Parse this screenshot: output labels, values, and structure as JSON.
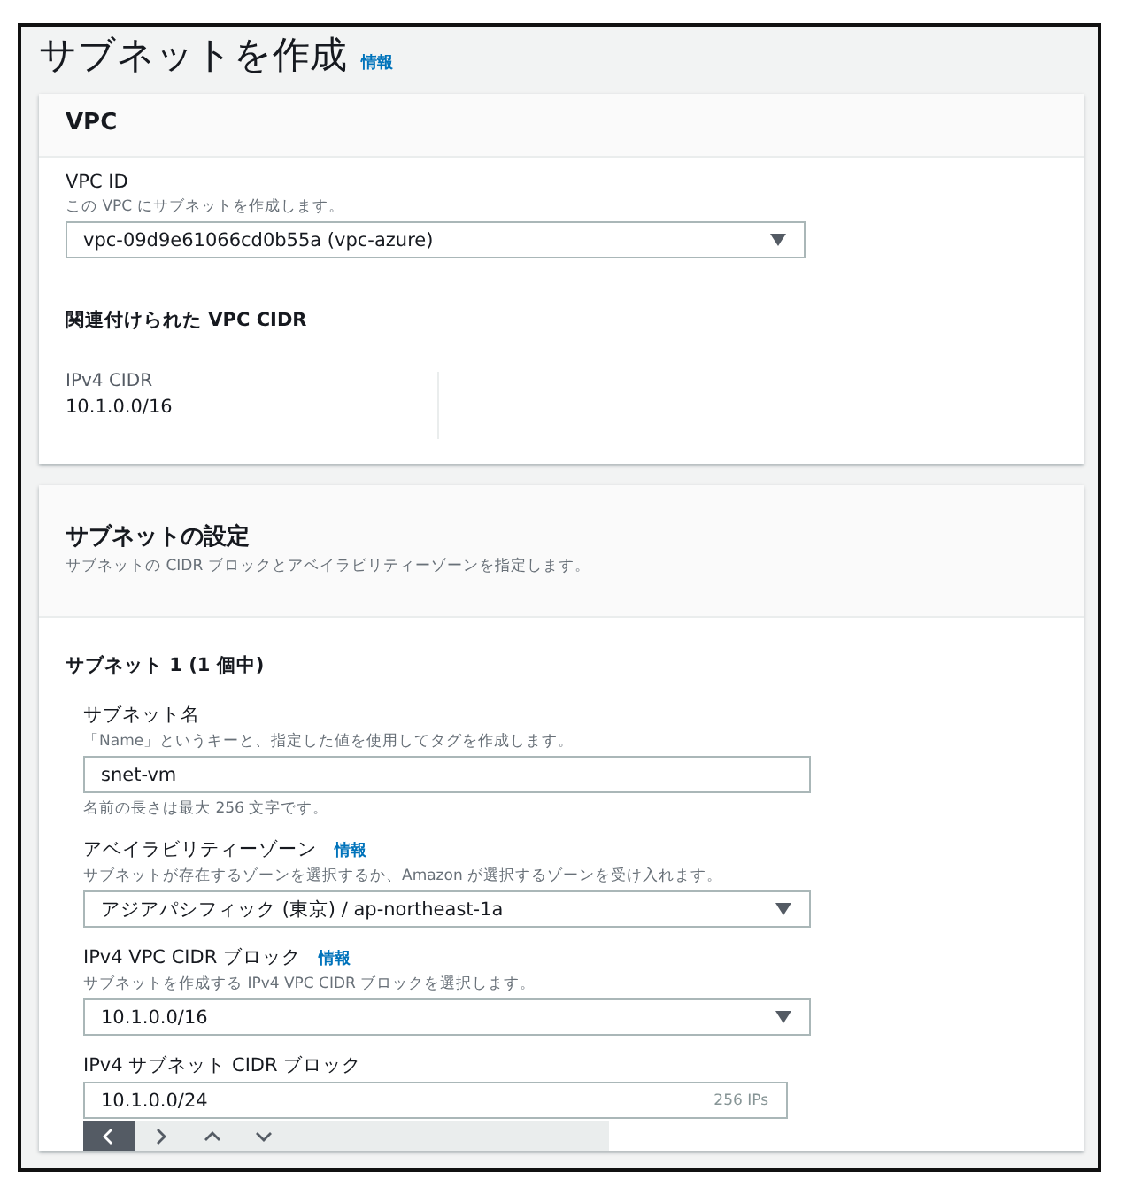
{
  "page": {
    "title": "サブネットを作成",
    "info_link": "情報"
  },
  "vpc_section": {
    "title": "VPC",
    "vpc_id": {
      "label": "VPC ID",
      "description": "この VPC にサブネットを作成します。",
      "value": "vpc-09d9e61066cd0b55a (vpc-azure)"
    },
    "cidr_heading": "関連付けられた VPC CIDR",
    "cidr_label": "IPv4 CIDR",
    "cidr_value": "10.1.0.0/16"
  },
  "subnet_section": {
    "title": "サブネットの設定",
    "description": "サブネットの CIDR ブロックとアベイラビリティーゾーンを指定します。",
    "subnet_heading": "サブネット 1 (1 個中)",
    "fields": [
      {
        "kind": "text",
        "label": "サブネット名",
        "description": "「Name」というキーと、指定した値を使用してタグを作成します。",
        "value": "snet-vm",
        "hint": "名前の長さは最大 256 文字です。"
      },
      {
        "kind": "select",
        "label": "アベイラビリティーゾーン",
        "info_link": "情報",
        "description": "サブネットが存在するゾーンを選択するか、Amazon が選択するゾーンを受け入れます。",
        "value": "アジアパシフィック (東京) / ap-northeast-1a"
      },
      {
        "kind": "select",
        "label": "IPv4 VPC CIDR ブロック",
        "info_link": "情報",
        "description": "サブネットを作成する IPv4 VPC CIDR ブロックを選択します。",
        "value": "10.1.0.0/16"
      },
      {
        "kind": "cidr",
        "label": "IPv4 サブネット CIDR ブロック",
        "value": "10.1.0.0/24",
        "suffix": "256 IPs"
      }
    ],
    "nav_buttons": [
      {
        "kind": "left",
        "selected": true
      },
      {
        "kind": "right",
        "selected": false
      },
      {
        "kind": "up",
        "selected": false
      },
      {
        "kind": "down",
        "selected": false
      }
    ]
  }
}
